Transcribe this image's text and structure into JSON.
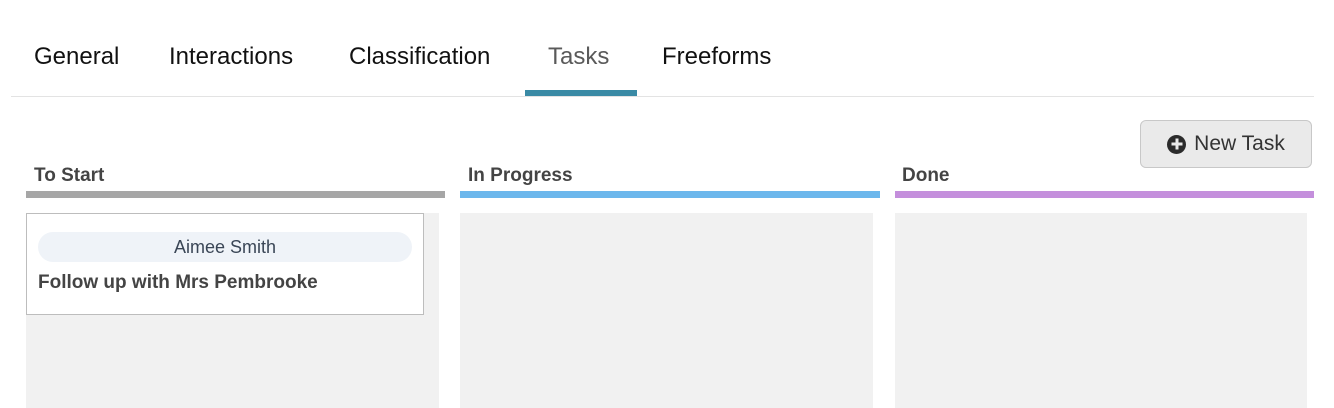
{
  "tabs": [
    {
      "label": "General"
    },
    {
      "label": "Interactions"
    },
    {
      "label": "Classification"
    },
    {
      "label": "Tasks",
      "active": true
    },
    {
      "label": "Freeforms"
    }
  ],
  "toolbar": {
    "new_task_label": "New Task",
    "new_task_icon": "plus-circle-icon"
  },
  "columns": [
    {
      "title": "To Start",
      "color": "#a6a6a6"
    },
    {
      "title": "In Progress",
      "color": "#6cb7ec"
    },
    {
      "title": "Done",
      "color": "#c48fdc"
    }
  ],
  "cards": [
    {
      "assignee": "Aimee Smith",
      "title": "Follow up with Mrs Pembrooke",
      "column": "To Start"
    }
  ],
  "colors": {
    "accent": "#3a8aa5",
    "column_bg": "#f1f1f1"
  }
}
